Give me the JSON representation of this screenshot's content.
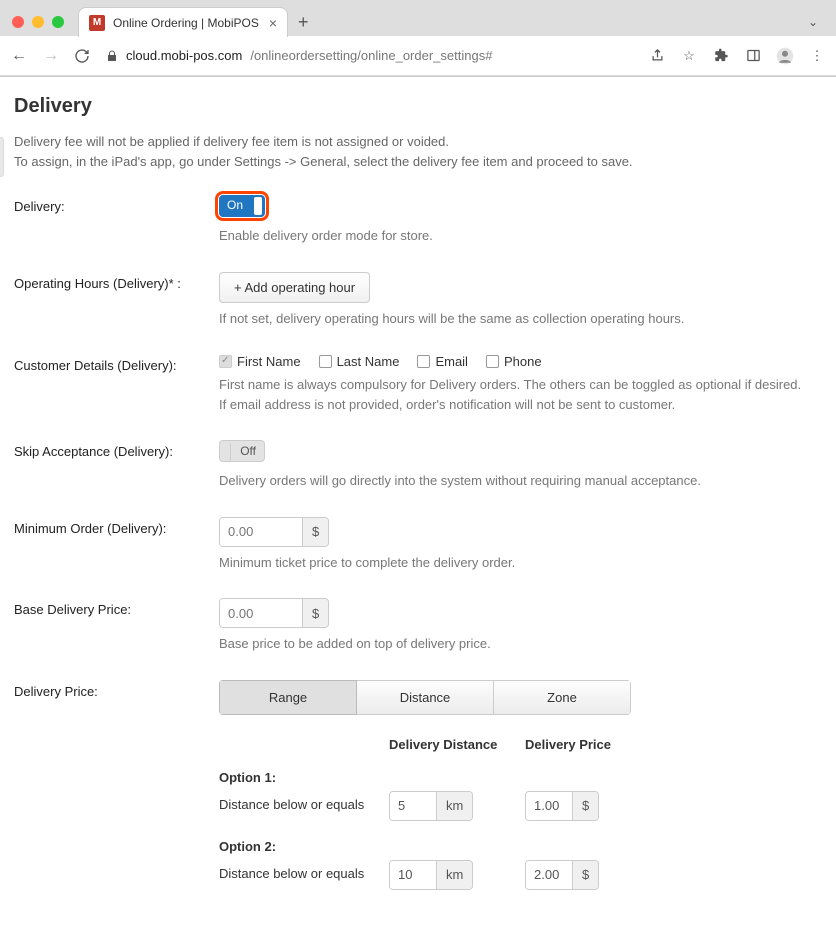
{
  "browser": {
    "tab_title": "Online Ordering | MobiPOS",
    "url_host": "cloud.mobi-pos.com",
    "url_path": "/onlineordersetting/online_order_settings#",
    "favicon_letter": "M"
  },
  "page": {
    "title": "Delivery",
    "desc_line1": "Delivery fee will not be applied if delivery fee item is not assigned or voided.",
    "desc_line2": "To assign, in the iPad's app, go under Settings -> General, select the delivery fee item and proceed to save."
  },
  "fields": {
    "delivery": {
      "label": "Delivery:",
      "toggle": "On",
      "hint": "Enable delivery order mode for store."
    },
    "operating_hours": {
      "label": "Operating Hours (Delivery)* :",
      "button": "+ Add operating hour",
      "hint": "If not set, delivery operating hours will be the same as collection operating hours."
    },
    "customer_details": {
      "label": "Customer Details (Delivery):",
      "checks": {
        "first_name": "First Name",
        "last_name": "Last Name",
        "email": "Email",
        "phone": "Phone"
      },
      "hint1": "First name is always compulsory for Delivery orders. The others can be toggled as optional if desired.",
      "hint2": "If email address is not provided, order's notification will not be sent to customer."
    },
    "skip_acceptance": {
      "label": "Skip Acceptance (Delivery):",
      "toggle": "Off",
      "hint": "Delivery orders will go directly into the system without requiring manual acceptance."
    },
    "minimum_order": {
      "label": "Minimum Order (Delivery):",
      "placeholder": "0.00",
      "suffix": "$",
      "hint": "Minimum ticket price to complete the delivery order."
    },
    "base_price": {
      "label": "Base Delivery Price:",
      "placeholder": "0.00",
      "suffix": "$",
      "hint": "Base price to be added on top of delivery price."
    },
    "delivery_price": {
      "label": "Delivery Price:",
      "tabs": {
        "range": "Range",
        "distance": "Distance",
        "zone": "Zone"
      },
      "headers": {
        "distance": "Delivery Distance",
        "price": "Delivery Price"
      },
      "options": [
        {
          "title": "Option 1:",
          "desc": "Distance below or equals",
          "distance": "5",
          "distance_unit": "km",
          "price": "1.00",
          "currency": "$"
        },
        {
          "title": "Option 2:",
          "desc": "Distance below or equals",
          "distance": "10",
          "distance_unit": "km",
          "price": "2.00",
          "currency": "$"
        }
      ]
    }
  }
}
